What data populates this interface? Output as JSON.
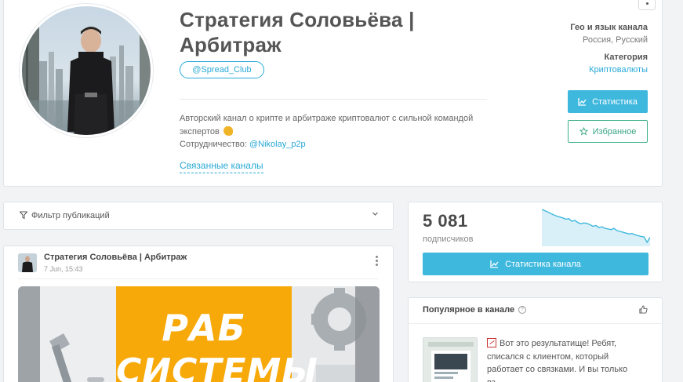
{
  "channel": {
    "title": "Стратегия Соловьёва | Арбитраж",
    "username": "@Spread_Club",
    "description": "Авторский канал о крипте и арбитраже криптовалют с сильной командой экспертов",
    "cooperation_label": "Сотрудничество:",
    "cooperation_contact": "@Nikolay_p2p",
    "related_link": "Связанные каналы"
  },
  "meta": {
    "geo_label": "Гео и язык канала",
    "geo_value": "Россия, Русский",
    "category_label": "Категория",
    "category_value": "Криптовалюты"
  },
  "buttons": {
    "statistics": "Статистика",
    "favorites": "Избранное",
    "channel_statistics": "Статистика канала"
  },
  "filter": {
    "label": "Фильтр публикаций"
  },
  "post": {
    "channel_name": "Стратегия Соловьёва | Арбитраж",
    "date": "7 Jun, 15:43",
    "image_text_line1": "РАБ",
    "image_text_line2": "СИСТЕМЫ"
  },
  "stats": {
    "subscribers": "5 081",
    "subscribers_label": "подписчиков",
    "sparkline": [
      100,
      97,
      94,
      90,
      87,
      84,
      82,
      80,
      77,
      78,
      72,
      74,
      69,
      66,
      68,
      67,
      64,
      60,
      62,
      57,
      59,
      55,
      54,
      52,
      55,
      50,
      48,
      46,
      44,
      42,
      43,
      40,
      38,
      36,
      35,
      22,
      34
    ]
  },
  "popular": {
    "title": "Популярное в канале",
    "post_text": "Вот это результатище! Ребят, списался с клиентом, который работает со связками. И вы только вз..."
  },
  "colors": {
    "accent": "#3fb8de",
    "link": "#29a9d6",
    "favorite": "#3aa485",
    "banner_yellow": "#f7a90a"
  },
  "icons": {
    "statistics": "chart-line-icon",
    "favorites": "star-icon",
    "filter": "funnel-icon",
    "dropdown": "chevron-down-icon",
    "help": "question-circle-icon",
    "like": "thumbs-up-icon",
    "menu": "kebab-menu-icon"
  }
}
